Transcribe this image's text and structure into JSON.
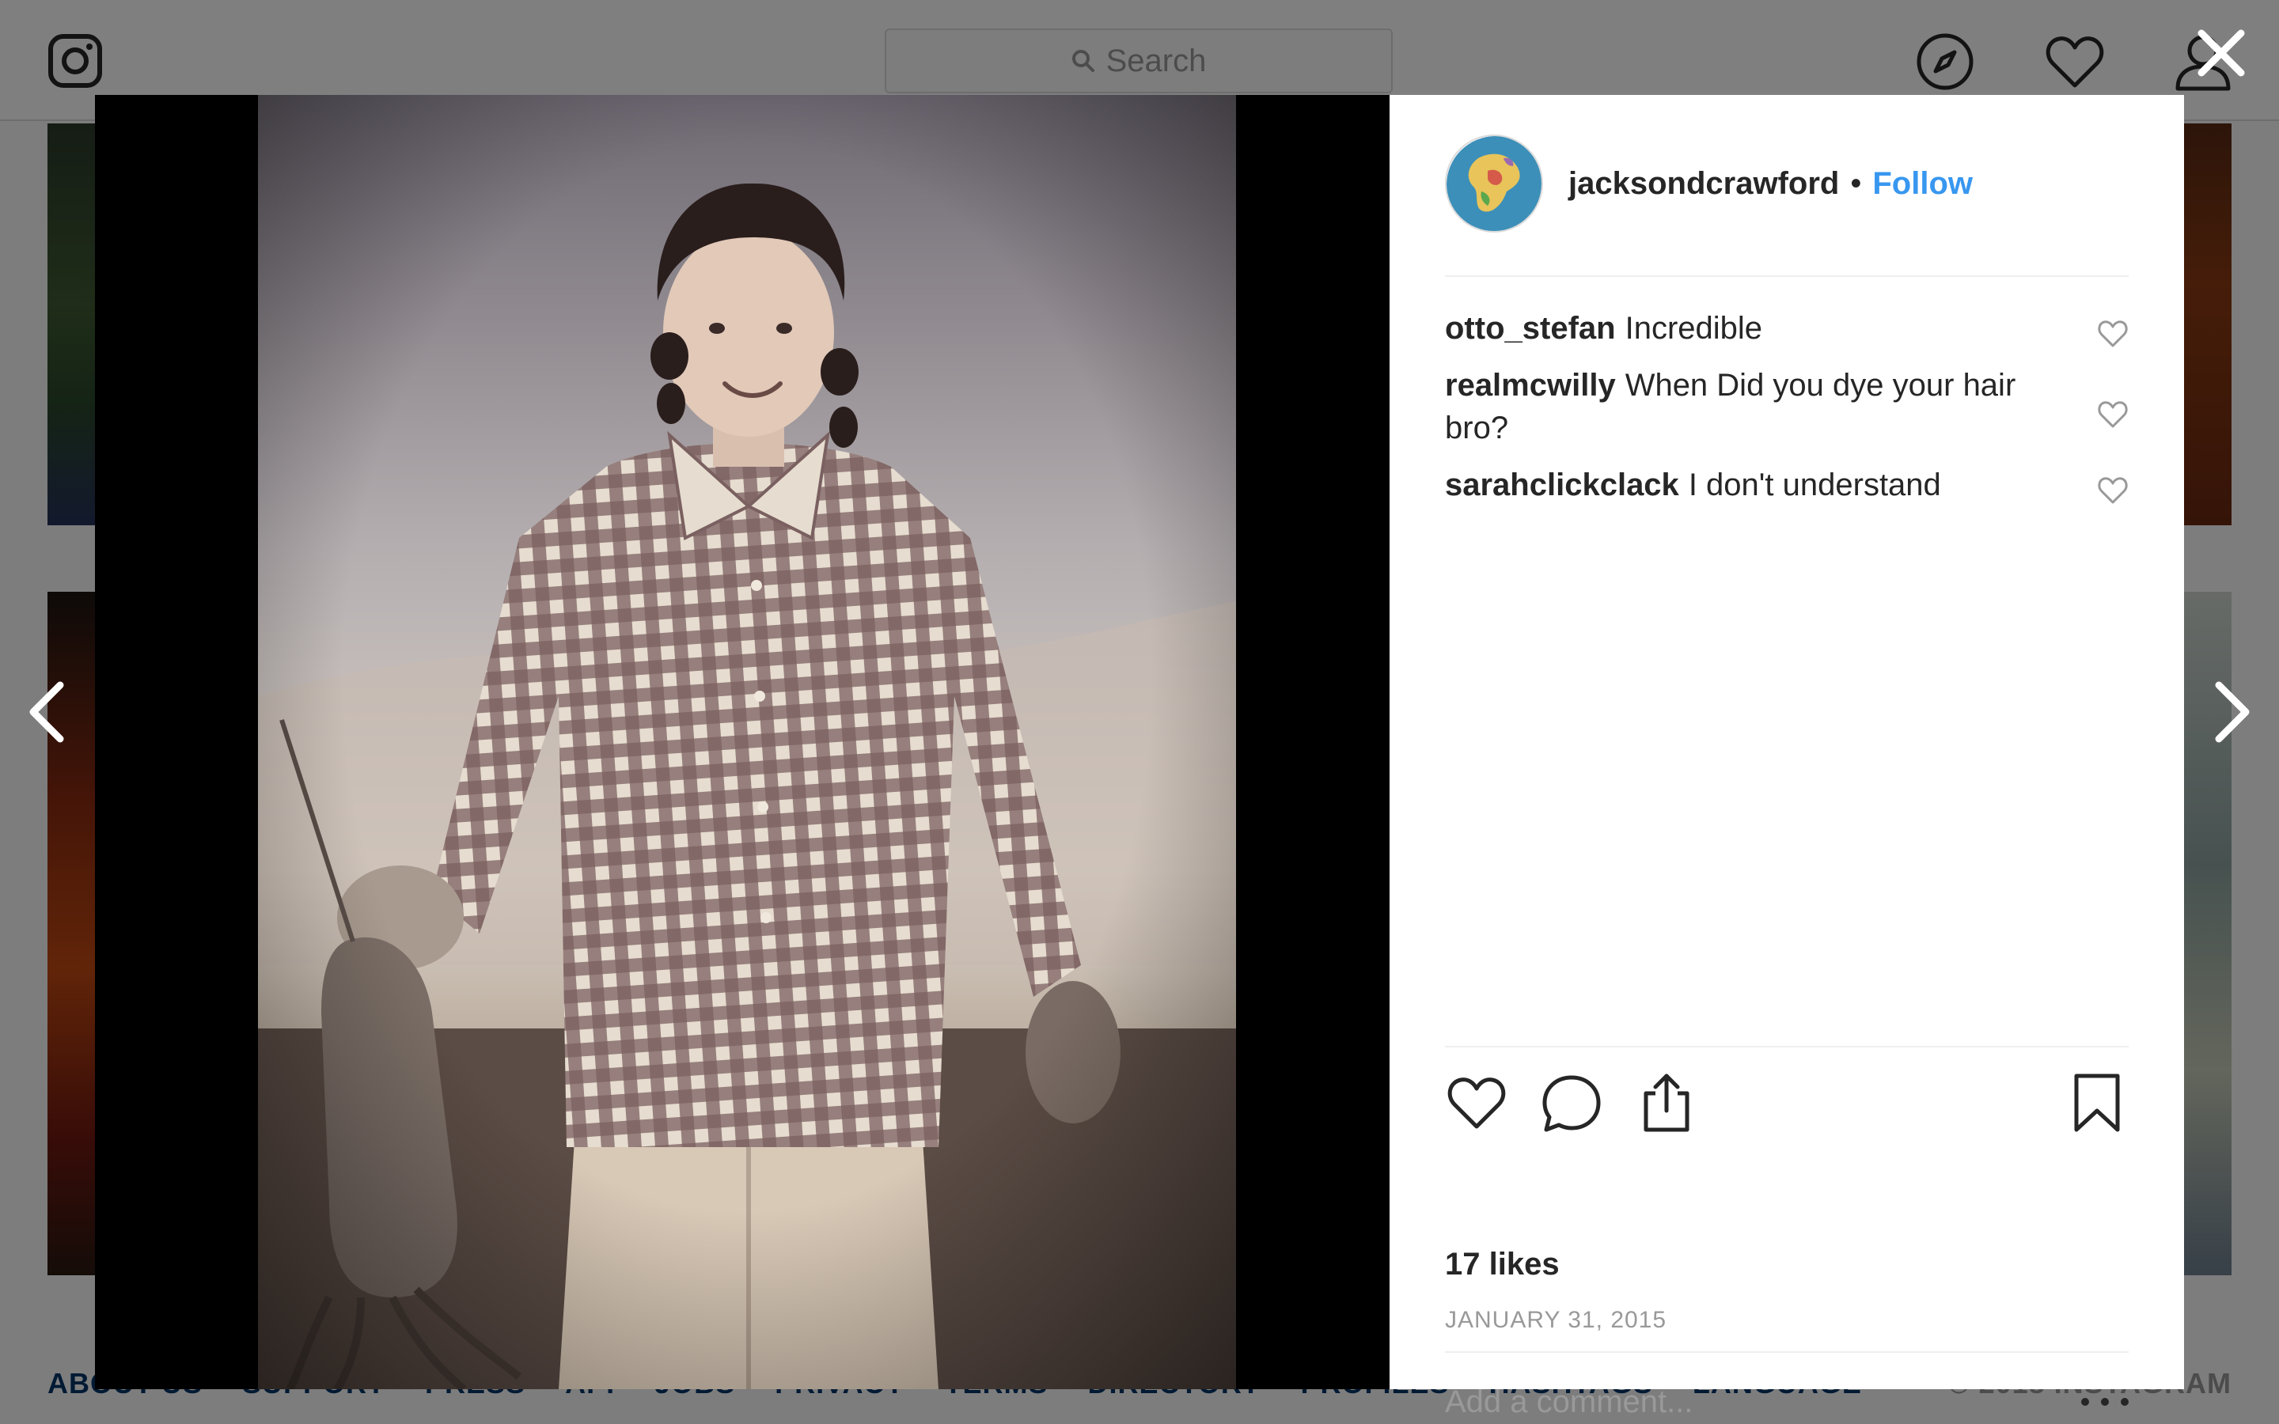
{
  "search": {
    "placeholder": "Search"
  },
  "footer": {
    "links": [
      "ABOUT US",
      "SUPPORT",
      "PRESS",
      "API",
      "JOBS",
      "PRIVACY",
      "TERMS",
      "DIRECTORY",
      "PROFILES",
      "HASHTAGS",
      "LANGUAGE"
    ],
    "copyright": "© 2018 INSTAGRAM"
  },
  "post": {
    "username": "jacksondcrawford",
    "separator": "•",
    "follow_label": "Follow",
    "comments": [
      {
        "author": "otto_stefan",
        "text": "Incredible"
      },
      {
        "author": "realmcwilly",
        "text": "When Did you dye your hair bro?"
      },
      {
        "author": "sarahclickclack",
        "text": "I don't understand"
      }
    ],
    "likes": "17 likes",
    "date": "JANUARY 31, 2015",
    "comment_placeholder": "Add a comment..."
  },
  "icons": {
    "logo": "instagram-icon",
    "explore": "compass-icon",
    "activity": "heart-icon",
    "profile": "user-icon",
    "close": "close-icon",
    "prev": "chevron-left-icon",
    "next": "chevron-right-icon"
  },
  "colors": {
    "link": "#3897f0",
    "text": "#262626",
    "muted": "#999999",
    "footer_link": "#003569"
  }
}
